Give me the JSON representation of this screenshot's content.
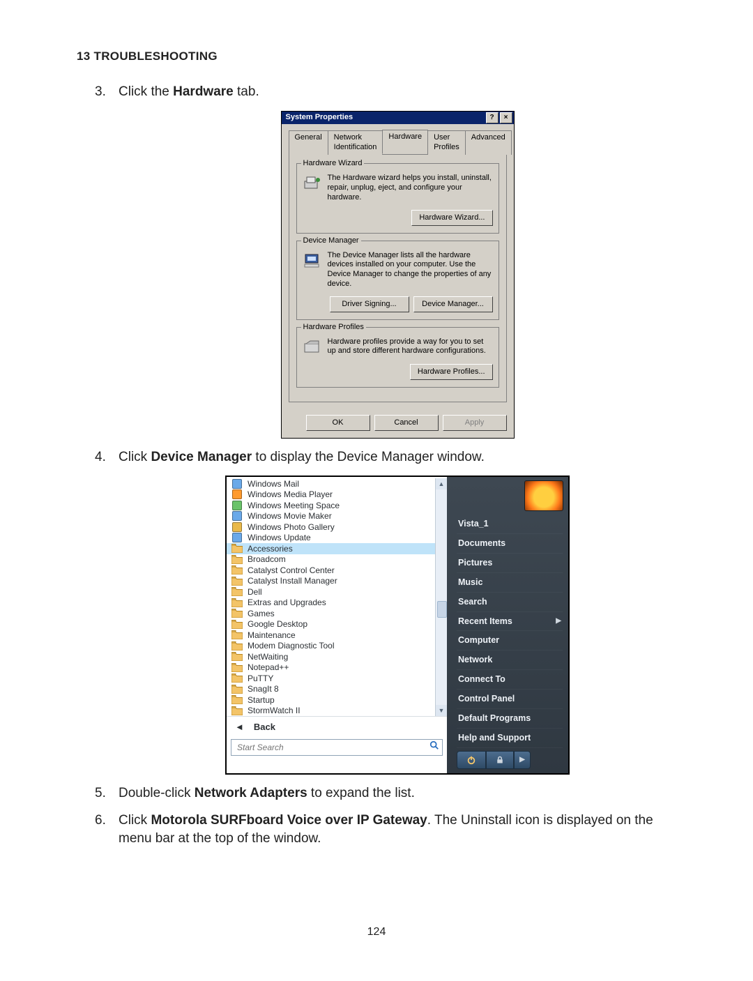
{
  "heading": "13 TROUBLESHOOTING",
  "steps": {
    "s3": {
      "num": "3.",
      "pre": "Click the ",
      "bold": "Hardware",
      "post": " tab."
    },
    "s4": {
      "num": "4.",
      "pre": "Click ",
      "bold": "Device Manager",
      "post": " to display the Device Manager window."
    },
    "s5": {
      "num": "5.",
      "pre": "Double-click ",
      "bold": "Network Adapters",
      "post": " to expand the list."
    },
    "s6": {
      "num": "6.",
      "pre": "Click ",
      "bold": "Motorola SURFboard Voice over IP Gateway",
      "post": ". The Uninstall icon is displayed on the menu bar at the top of the window."
    }
  },
  "dialog": {
    "title": "System Properties",
    "tabs": {
      "general": "General",
      "netid": "Network Identification",
      "hardware": "Hardware",
      "profiles": "User Profiles",
      "advanced": "Advanced"
    },
    "hw_wizard": {
      "label": "Hardware Wizard",
      "text": "The Hardware wizard helps you install, uninstall, repair, unplug, eject, and configure your hardware.",
      "button": "Hardware Wizard..."
    },
    "dev_mgr": {
      "label": "Device Manager",
      "text": "The Device Manager lists all the hardware devices installed on your computer. Use the Device Manager to change the properties of any device.",
      "btn_sign": "Driver Signing...",
      "btn_mgr": "Device Manager..."
    },
    "hw_profiles": {
      "label": "Hardware Profiles",
      "text": "Hardware profiles provide a way for you to set up and store different hardware configurations.",
      "button": "Hardware Profiles..."
    },
    "footer": {
      "ok": "OK",
      "cancel": "Cancel",
      "apply": "Apply"
    }
  },
  "vista": {
    "programs": [
      {
        "label": "Windows Mail",
        "icon": "app",
        "color": "#6aa9e9"
      },
      {
        "label": "Windows Media Player",
        "icon": "app",
        "color": "#ff9a2e"
      },
      {
        "label": "Windows Meeting Space",
        "icon": "app",
        "color": "#6ac36a"
      },
      {
        "label": "Windows Movie Maker",
        "icon": "app",
        "color": "#6aa9e9"
      },
      {
        "label": "Windows Photo Gallery",
        "icon": "app",
        "color": "#e9b94a"
      },
      {
        "label": "Windows Update",
        "icon": "app",
        "color": "#6aa9e9"
      },
      {
        "label": "Accessories",
        "icon": "folder",
        "selected": true
      },
      {
        "label": "Broadcom",
        "icon": "folder"
      },
      {
        "label": "Catalyst Control Center",
        "icon": "folder"
      },
      {
        "label": "Catalyst Install Manager",
        "icon": "folder"
      },
      {
        "label": "Dell",
        "icon": "folder"
      },
      {
        "label": "Extras and Upgrades",
        "icon": "folder"
      },
      {
        "label": "Games",
        "icon": "folder"
      },
      {
        "label": "Google Desktop",
        "icon": "folder"
      },
      {
        "label": "Maintenance",
        "icon": "folder"
      },
      {
        "label": "Modem Diagnostic Tool",
        "icon": "folder"
      },
      {
        "label": "NetWaiting",
        "icon": "folder"
      },
      {
        "label": "Notepad++",
        "icon": "folder"
      },
      {
        "label": "PuTTY",
        "icon": "folder"
      },
      {
        "label": "SnagIt 8",
        "icon": "folder"
      },
      {
        "label": "Startup",
        "icon": "folder"
      },
      {
        "label": "StormWatch II",
        "icon": "folder"
      }
    ],
    "back": "Back",
    "searchPlaceholder": "Start Search",
    "right": {
      "user": "Vista_1",
      "items": [
        "Documents",
        "Pictures",
        "Music",
        "Search",
        "Recent Items",
        "Computer",
        "Network",
        "Connect To",
        "Control Panel",
        "Default Programs",
        "Help and Support"
      ],
      "submenuIndex": 4
    }
  },
  "pageNumber": "124"
}
